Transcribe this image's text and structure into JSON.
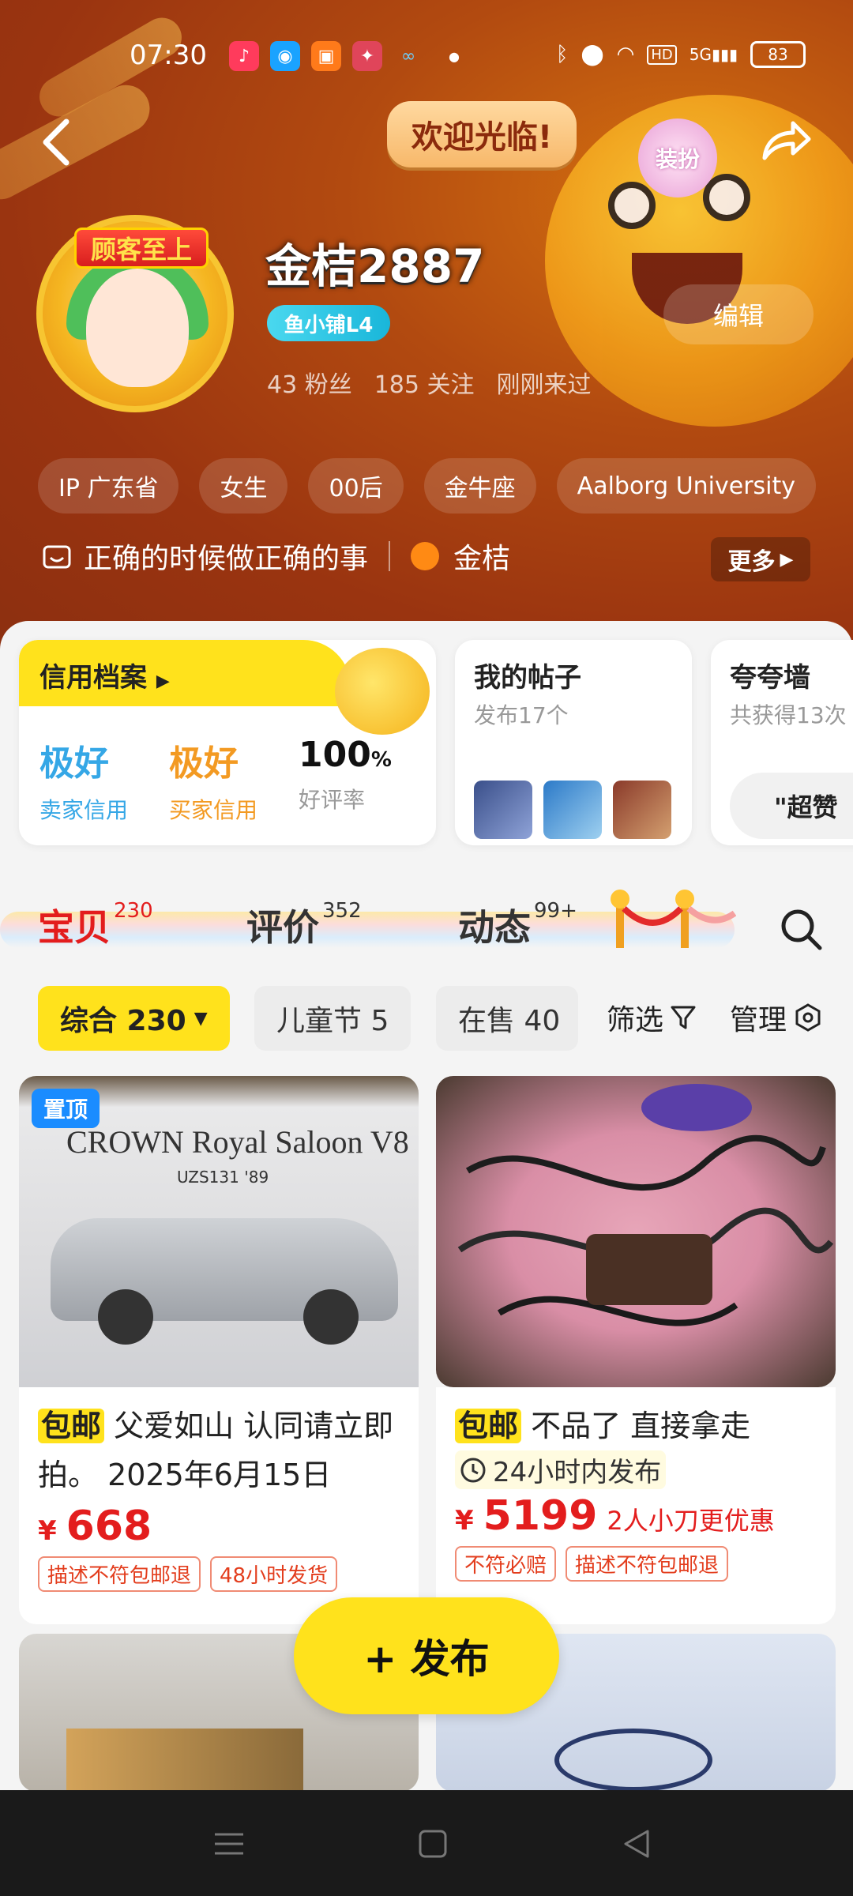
{
  "status_bar": {
    "time": "07:30",
    "battery": "83",
    "network": "5G"
  },
  "header": {
    "welcome": "欢迎光临!",
    "dress_up": "装扮",
    "username": "金桔2887",
    "level": "鱼小铺L4",
    "edit": "编辑",
    "stats": {
      "fans": "43 粉丝",
      "follows": "185 关注",
      "last_seen": "刚刚来过"
    },
    "avatar_banner": "顾客至上",
    "tags": [
      "IP 广东省",
      "女生",
      "00后",
      "金牛座",
      "Aalborg University"
    ],
    "bio": "正确的时候做正确的事",
    "bio_name": "金桔",
    "more": "更多"
  },
  "credit": {
    "title": "信用档案",
    "seller": {
      "value": "极好",
      "label": "卖家信用",
      "color": "#35a7e6"
    },
    "buyer": {
      "value": "极好",
      "label": "买家信用",
      "color": "#f39a22"
    },
    "rate": {
      "value": "100",
      "unit": "%",
      "label": "好评率"
    }
  },
  "posts": {
    "title": "我的帖子",
    "sub": "发布17个"
  },
  "praise": {
    "title": "夸夸墙",
    "sub": "共获得13次",
    "chip": "\"超赞"
  },
  "tabs": [
    {
      "label": "宝贝",
      "count": "230"
    },
    {
      "label": "评价",
      "count": "352"
    },
    {
      "label": "动态",
      "count": "99+"
    }
  ],
  "filters": {
    "chips": [
      "综合 230",
      "儿童节 5",
      "在售 40"
    ],
    "filter": "筛选",
    "manage": "管理"
  },
  "products": [
    {
      "pinned": "置顶",
      "free_ship": "包邮",
      "title": " 父爱如山 认同请立即拍。 2025年6月15日",
      "currency": "¥",
      "price": "668",
      "tags": [
        "描述不符包邮退",
        "48小时发货"
      ],
      "image_text": "CROWN Royal Saloon V8",
      "image_sub": "UZS131 '89"
    },
    {
      "free_ship": "包邮",
      "title": " 不品了 直接拿走",
      "sub": "24小时内发布",
      "currency": "¥",
      "price": "5199",
      "price_extra": "2人小刀更优惠",
      "tags": [
        "不符必赔",
        "描述不符包邮退"
      ]
    }
  ],
  "publish": "+ 发布",
  "colors": {
    "accent_yellow": "#ffe21c",
    "price_red": "#e31d1d",
    "header_brown": "#9a3410"
  }
}
